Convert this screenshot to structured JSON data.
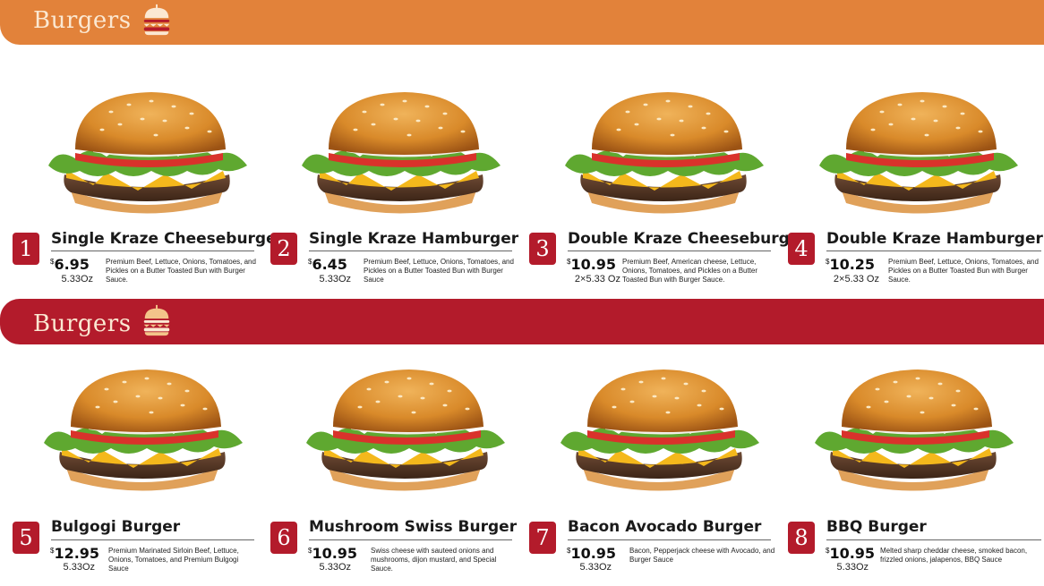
{
  "sections": [
    {
      "title": "Burgers",
      "color": "#e2823a",
      "icon": "burger-icon"
    },
    {
      "title": "Burgers",
      "color": "#b31b2b",
      "icon": "burger-icon"
    }
  ],
  "items": [
    {
      "num": "1",
      "name": "Single Kraze Cheeseburger",
      "currency": "$",
      "price": "6.95",
      "weight": "5.33Oz",
      "desc": "Premium Beef, Lettuce, Onions, Tomatoes, and Pickles on a Butter Toasted Bun with Burger Sauce."
    },
    {
      "num": "2",
      "name": "Single Kraze Hamburger",
      "currency": "$",
      "price": "6.45",
      "weight": "5.33Oz",
      "desc": "Premium Beef, Lettuce, Onions, Tomatoes, and Pickles on a Butter Toasted Bun with Burger Sauce"
    },
    {
      "num": "3",
      "name": "Double Kraze Cheeseburger",
      "currency": "$",
      "price": "10.95",
      "weight": "2×5.33 Oz",
      "desc": "Premium Beef, American cheese, Lettuce, Onions, Tomatoes, and Pickles on a Butter Toasted Bun with Burger Sauce."
    },
    {
      "num": "4",
      "name": "Double Kraze Hamburger",
      "currency": "$",
      "price": "10.25",
      "weight": "2×5.33 Oz",
      "desc": "Premium Beef, Lettuce, Onions, Tomatoes, and Pickles on a Butter Toasted Bun with Burger Sauce."
    },
    {
      "num": "5",
      "name": "Bulgogi Burger",
      "currency": "$",
      "price": "12.95",
      "weight": "5.33Oz",
      "desc": "Premium Marinated Sirloin Beef, Lettuce, Onions, Tomatoes, and Premium Bulgogi Sauce"
    },
    {
      "num": "6",
      "name": "Mushroom Swiss Burger",
      "currency": "$",
      "price": "10.95",
      "weight": "5.33Oz",
      "desc": "Swiss cheese with sauteed onions and mushrooms, dijon mustard, and Special Sauce."
    },
    {
      "num": "7",
      "name": "Bacon Avocado Burger",
      "currency": "$",
      "price": "10.95",
      "weight": "5.33Oz",
      "desc": "Bacon, Pepperjack cheese with Avocado, and Burger Sauce"
    },
    {
      "num": "8",
      "name": "BBQ Burger",
      "currency": "$",
      "price": "10.95",
      "weight": "5.33Oz",
      "desc": "Melted sharp cheddar cheese, smoked bacon, frizzled onions, jalapenos, BBQ Sauce"
    }
  ]
}
